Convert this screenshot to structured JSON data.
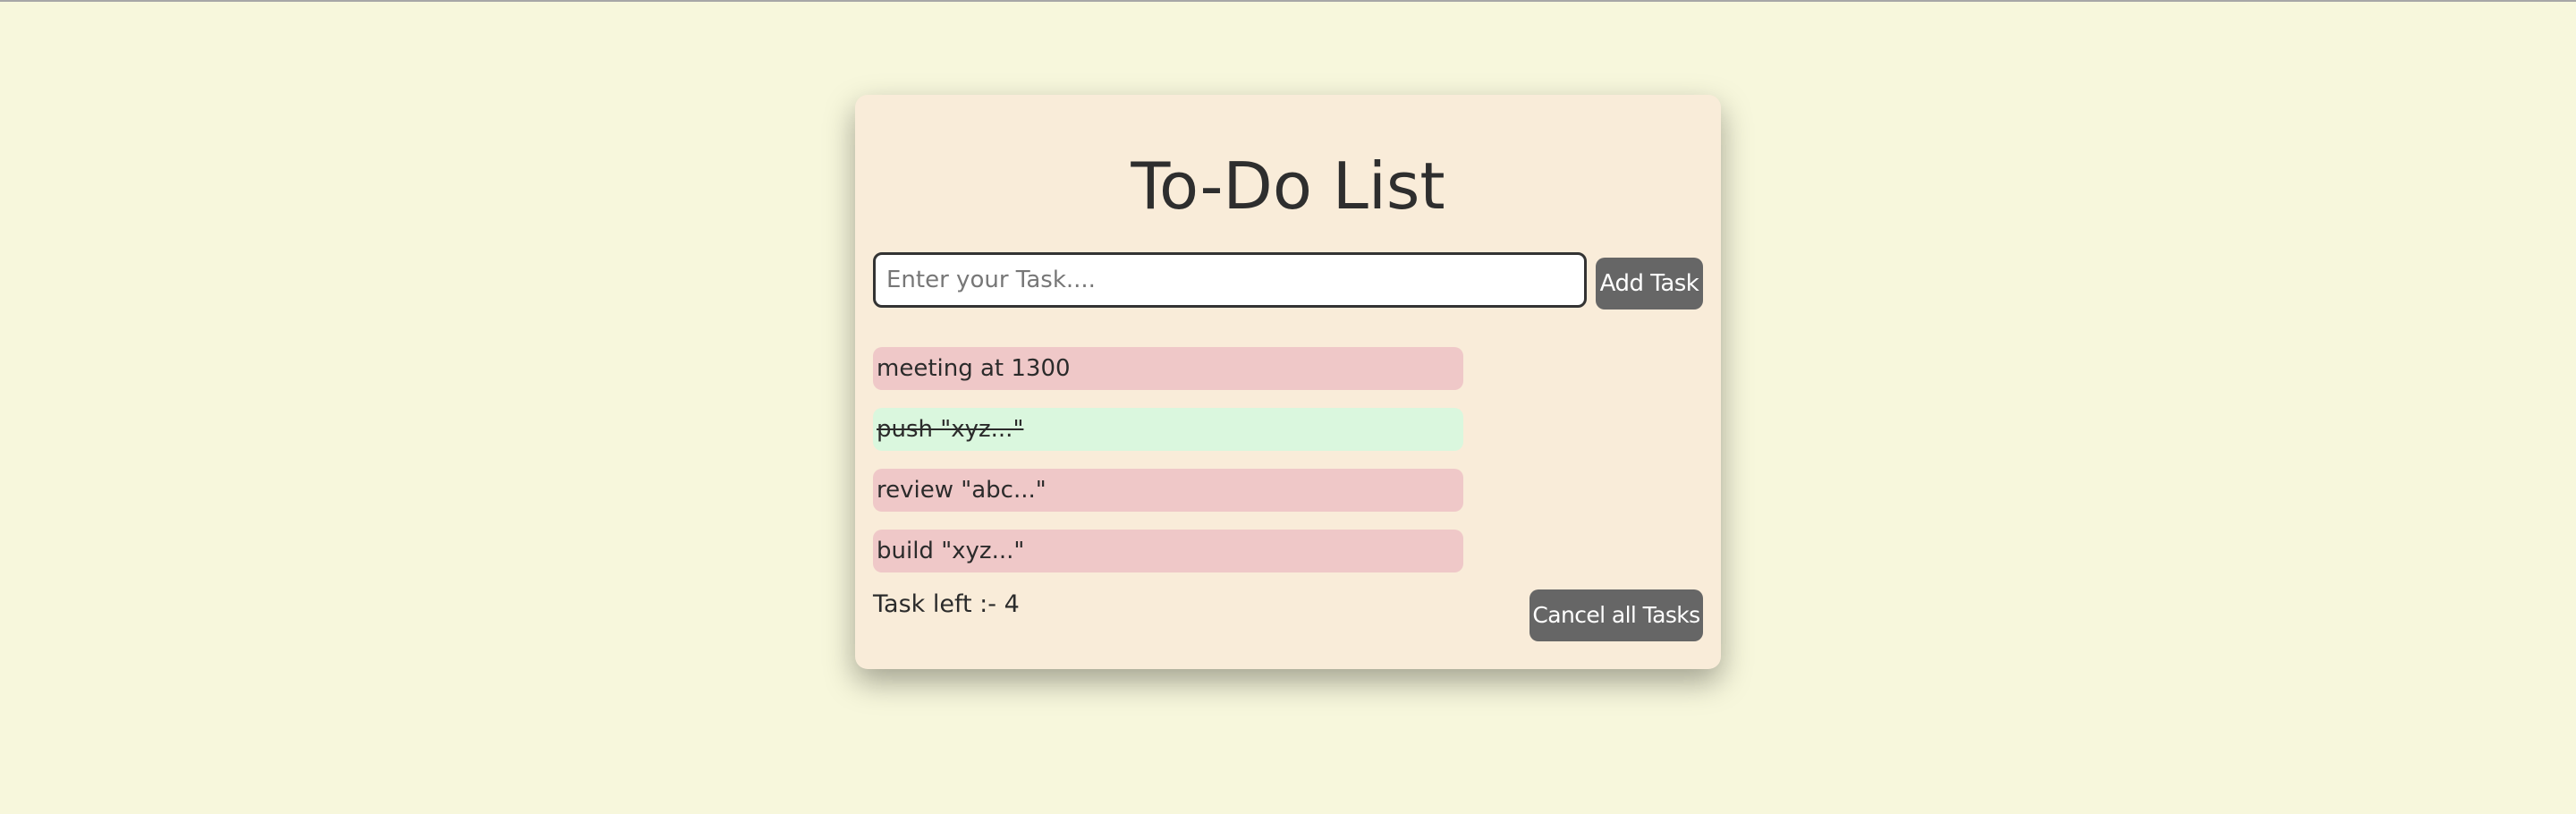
{
  "app": {
    "title": "To-Do List"
  },
  "input": {
    "placeholder": "Enter your Task....",
    "value": ""
  },
  "buttons": {
    "add_task": "Add Task",
    "cancel_all": "Cancel all Tasks"
  },
  "tasks": [
    {
      "text": "meeting at 1300",
      "status": "pending"
    },
    {
      "text": "push \"xyz...\"",
      "status": "done"
    },
    {
      "text": "review \"abc...\"",
      "status": "pending"
    },
    {
      "text": "build \"xyz...\"",
      "status": "pending"
    }
  ],
  "footer": {
    "task_left_label": "Task left :- 4"
  },
  "colors": {
    "page_background": "#f7f7dc",
    "card_background": "#f9ecd9",
    "pending_task": "#efc8c8",
    "done_task": "#daf7de",
    "button": "#666666",
    "button_text": "#ffffff"
  }
}
